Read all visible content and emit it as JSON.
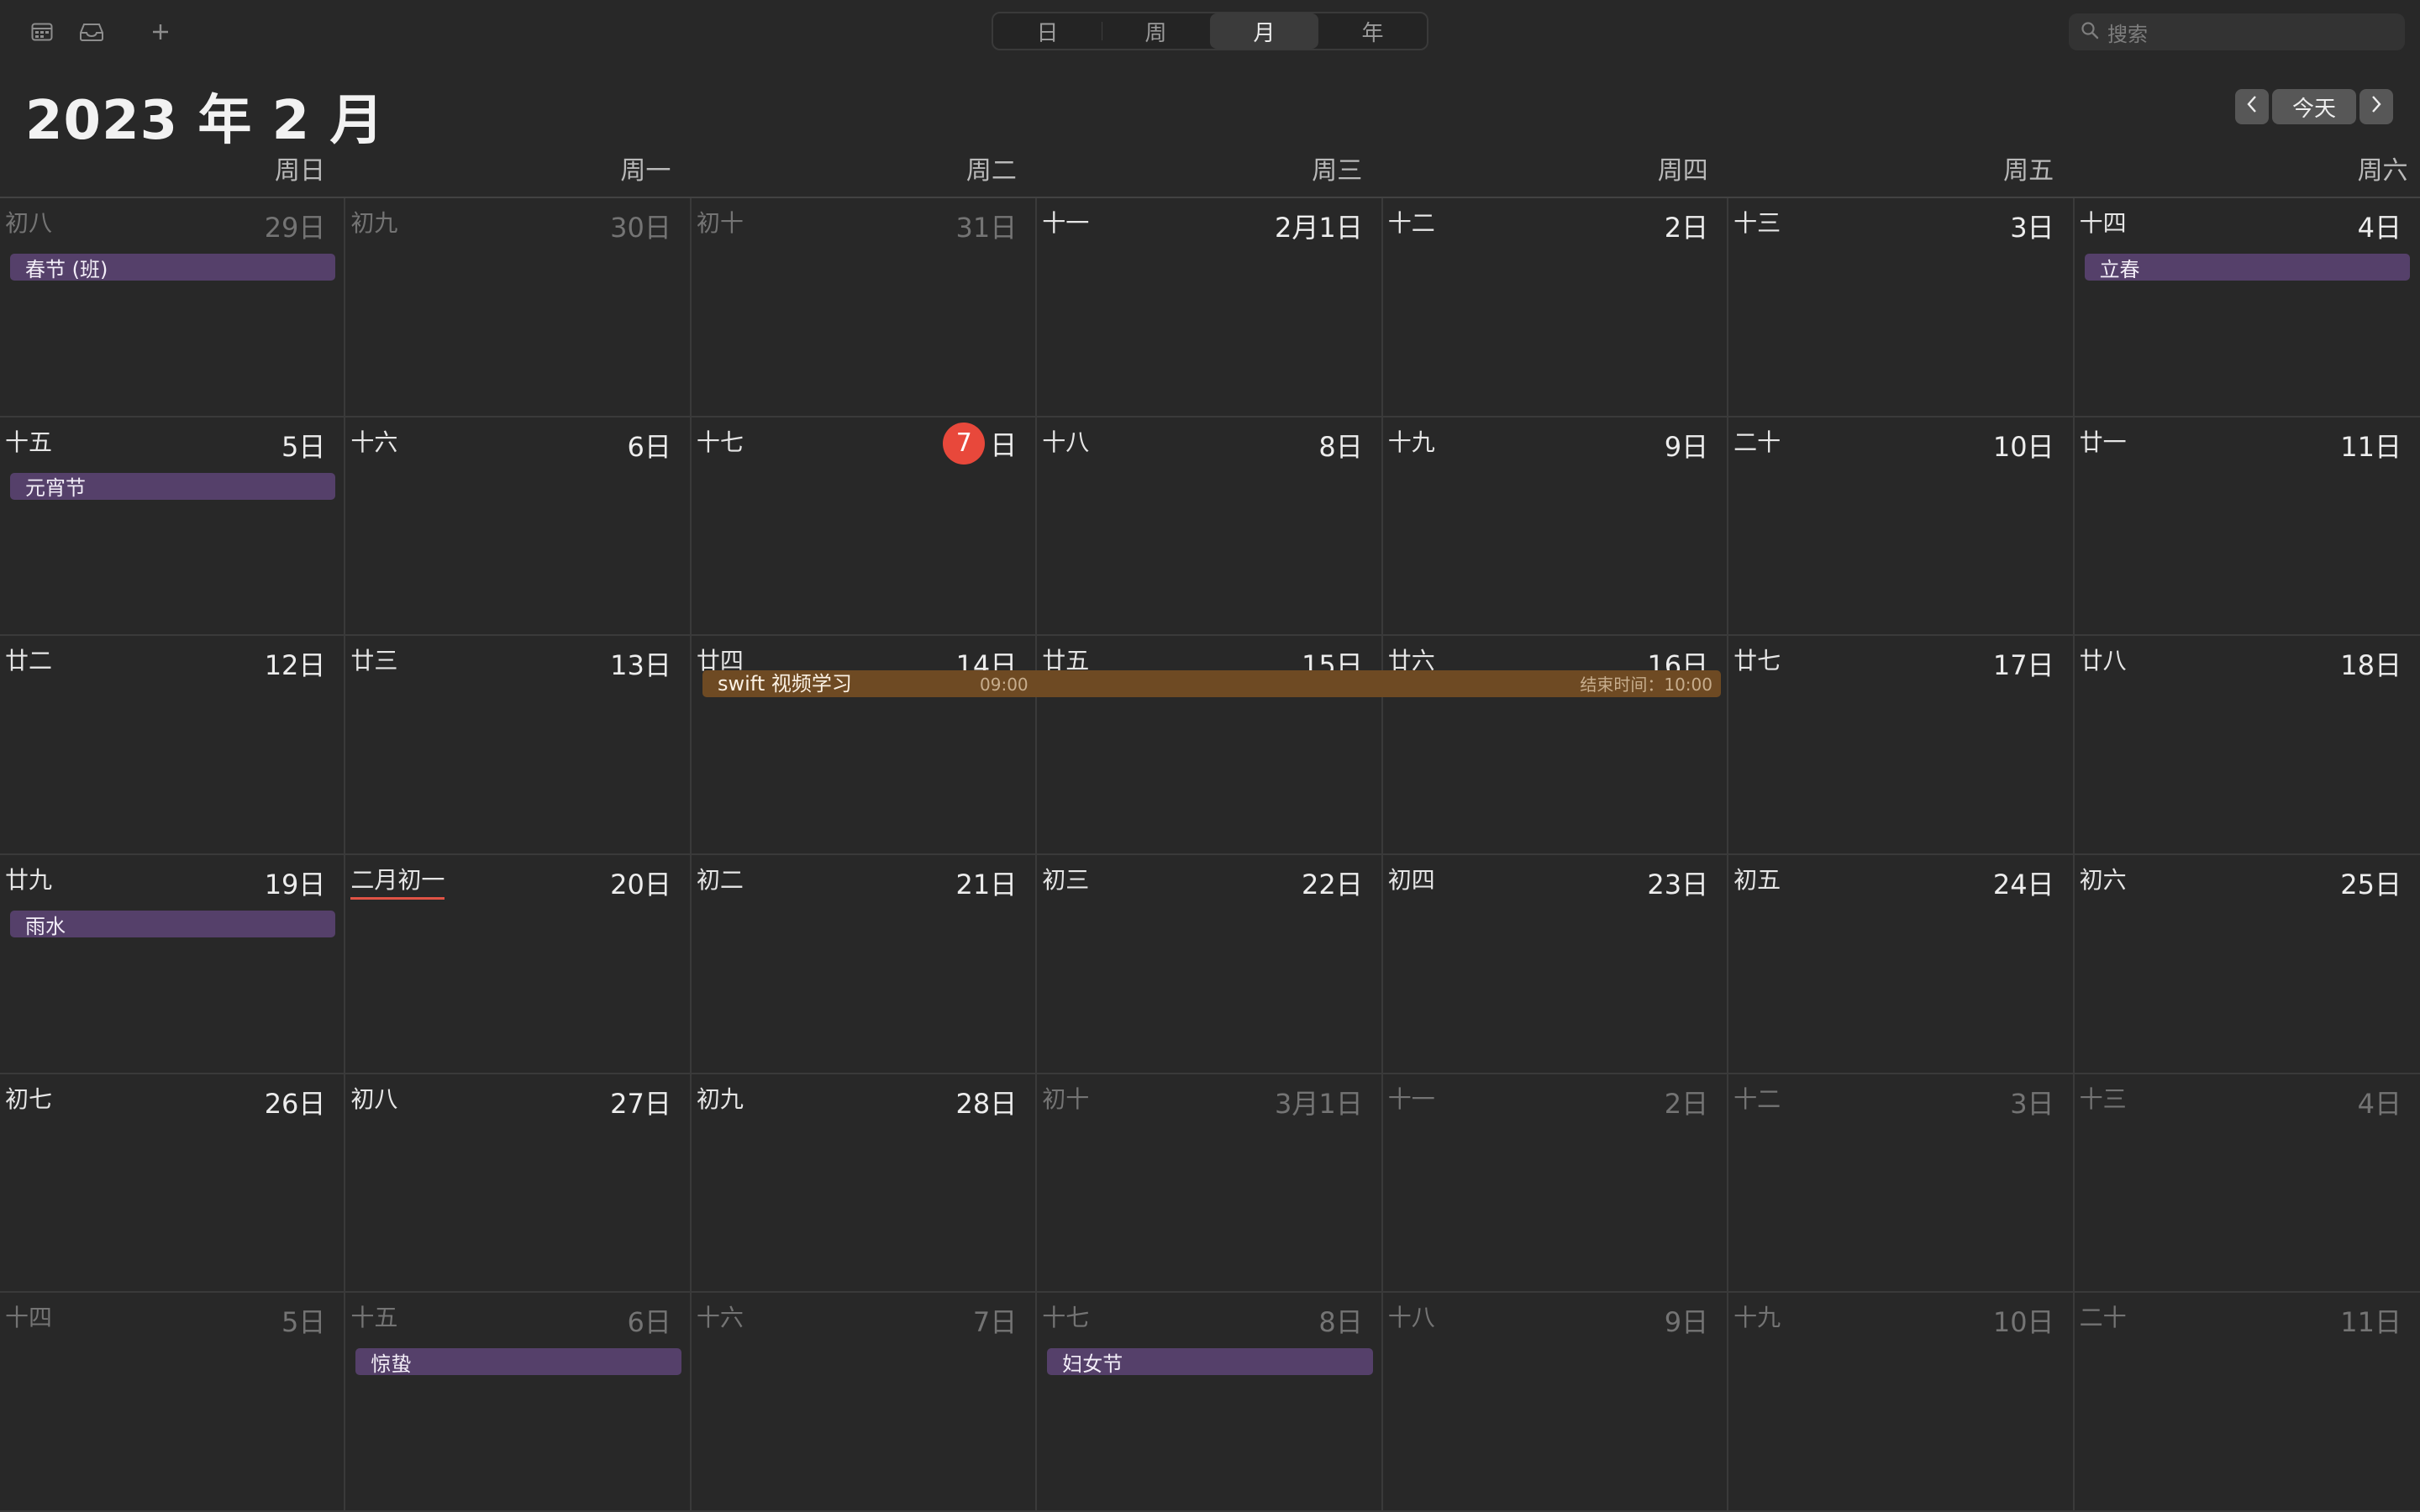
{
  "toolbar": {
    "left_icons": [
      "calendar-list-icon",
      "inbox-icon",
      "plus-icon"
    ],
    "view_tabs": [
      {
        "label": "日",
        "active": false
      },
      {
        "label": "周",
        "active": false
      },
      {
        "label": "月",
        "active": true
      },
      {
        "label": "年",
        "active": false
      }
    ],
    "search": {
      "placeholder": "搜索",
      "icon": "search-icon"
    }
  },
  "header": {
    "title": "2023 年 2 月",
    "today_button": "今天",
    "prev_icon": "chevron-left-icon",
    "next_icon": "chevron-right-icon",
    "weekdays": [
      "周日",
      "周一",
      "周二",
      "周三",
      "周四",
      "周五",
      "周六"
    ]
  },
  "weeks": [
    [
      {
        "lunar": "初八",
        "day": "29日",
        "dim": true
      },
      {
        "lunar": "初九",
        "day": "30日",
        "dim": true
      },
      {
        "lunar": "初十",
        "day": "31日",
        "dim": true
      },
      {
        "lunar": "十一",
        "day": "2月1日"
      },
      {
        "lunar": "十二",
        "day": "2日"
      },
      {
        "lunar": "十三",
        "day": "3日"
      },
      {
        "lunar": "十四",
        "day": "4日"
      }
    ],
    [
      {
        "lunar": "十五",
        "day": "5日"
      },
      {
        "lunar": "十六",
        "day": "6日"
      },
      {
        "lunar": "十七",
        "day": "7",
        "today": true,
        "day_suffix": "日"
      },
      {
        "lunar": "十八",
        "day": "8日"
      },
      {
        "lunar": "十九",
        "day": "9日"
      },
      {
        "lunar": "二十",
        "day": "10日"
      },
      {
        "lunar": "廿一",
        "day": "11日"
      }
    ],
    [
      {
        "lunar": "廿二",
        "day": "12日"
      },
      {
        "lunar": "廿三",
        "day": "13日"
      },
      {
        "lunar": "廿四",
        "day": "14日"
      },
      {
        "lunar": "廿五",
        "day": "15日"
      },
      {
        "lunar": "廿六",
        "day": "16日"
      },
      {
        "lunar": "廿七",
        "day": "17日"
      },
      {
        "lunar": "廿八",
        "day": "18日"
      }
    ],
    [
      {
        "lunar": "廿九",
        "day": "19日"
      },
      {
        "lunar": "二月初一",
        "day": "20日",
        "new_month": true
      },
      {
        "lunar": "初二",
        "day": "21日"
      },
      {
        "lunar": "初三",
        "day": "22日"
      },
      {
        "lunar": "初四",
        "day": "23日"
      },
      {
        "lunar": "初五",
        "day": "24日"
      },
      {
        "lunar": "初六",
        "day": "25日"
      }
    ],
    [
      {
        "lunar": "初七",
        "day": "26日"
      },
      {
        "lunar": "初八",
        "day": "27日"
      },
      {
        "lunar": "初九",
        "day": "28日"
      },
      {
        "lunar": "初十",
        "day": "3月1日",
        "dim": true
      },
      {
        "lunar": "十一",
        "day": "2日",
        "dim": true
      },
      {
        "lunar": "十二",
        "day": "3日",
        "dim": true
      },
      {
        "lunar": "十三",
        "day": "4日",
        "dim": true
      }
    ],
    [
      {
        "lunar": "十四",
        "day": "5日",
        "dim": true
      },
      {
        "lunar": "十五",
        "day": "6日",
        "dim": true
      },
      {
        "lunar": "十六",
        "day": "7日",
        "dim": true
      },
      {
        "lunar": "十七",
        "day": "8日",
        "dim": true
      },
      {
        "lunar": "十八",
        "day": "9日",
        "dim": true
      },
      {
        "lunar": "十九",
        "day": "10日",
        "dim": true
      },
      {
        "lunar": "二十",
        "day": "11日",
        "dim": true
      }
    ]
  ],
  "holiday_events": [
    {
      "title": "春节 (班)",
      "week": 0,
      "col": 0
    },
    {
      "title": "立春",
      "week": 0,
      "col": 6
    },
    {
      "title": "元宵节",
      "week": 1,
      "col": 0
    },
    {
      "title": "雨水",
      "week": 3,
      "col": 0
    },
    {
      "title": "惊蛰",
      "week": 5,
      "col": 1
    },
    {
      "title": "妇女节",
      "week": 5,
      "col": 3
    }
  ],
  "timed_event": {
    "title": "swift 视频学习",
    "start": "09:00",
    "end": "结束时间：10:00",
    "color": "#6e4a23"
  },
  "colors": {
    "today": "#e8483b",
    "holiday": "#55406a",
    "background": "#282828"
  }
}
